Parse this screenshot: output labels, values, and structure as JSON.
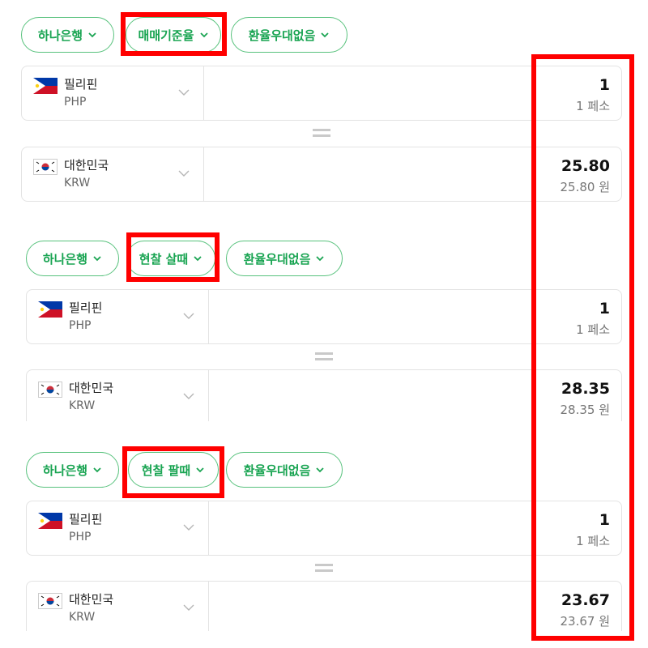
{
  "panels": [
    {
      "bank": "하나은행",
      "rate_type": "매매기준율",
      "discount": "환율우대없음",
      "from": {
        "name": "필리핀",
        "code": "PHP",
        "amount": "1",
        "unit": "1 페소"
      },
      "to": {
        "name": "대한민국",
        "code": "KRW",
        "amount": "25.80",
        "unit": "25.80 원"
      }
    },
    {
      "bank": "하나은행",
      "rate_type": "현찰 살때",
      "discount": "환율우대없음",
      "from": {
        "name": "필리핀",
        "code": "PHP",
        "amount": "1",
        "unit": "1 페소"
      },
      "to": {
        "name": "대한민국",
        "code": "KRW",
        "amount": "28.35",
        "unit": "28.35 원"
      }
    },
    {
      "bank": "하나은행",
      "rate_type": "현찰 팔때",
      "discount": "환율우대없음",
      "from": {
        "name": "필리핀",
        "code": "PHP",
        "amount": "1",
        "unit": "1 페소"
      },
      "to": {
        "name": "대한민국",
        "code": "KRW",
        "amount": "23.67",
        "unit": "23.67 원"
      }
    }
  ],
  "icons": {
    "chevron": "chevron-down-icon",
    "equals": "equals-icon",
    "ph_flag": "philippines-flag-icon",
    "kr_flag": "korea-flag-icon"
  },
  "colors": {
    "accent_green": "#19a452",
    "highlight_red": "#ff0000"
  }
}
